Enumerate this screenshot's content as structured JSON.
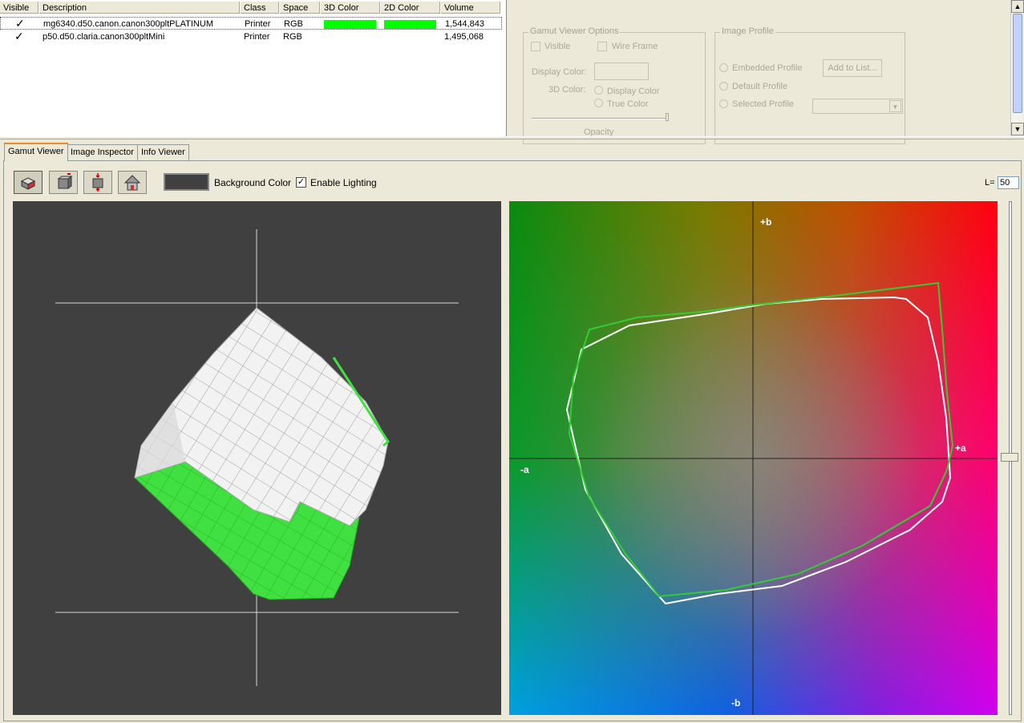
{
  "table": {
    "headers": [
      "Visible",
      "Description",
      "Class",
      "Space",
      "3D Color",
      "2D Color",
      "Volume"
    ],
    "rows": [
      {
        "visible": "✓",
        "description": "mg6340.d50.canon.canon300pltPLATINUM",
        "class": "Printer",
        "space": "RGB",
        "color3d": "#00ff00",
        "color2d": "#00ff00",
        "volume": "1,544,843"
      },
      {
        "visible": "✓",
        "description": "p50.d50.claria.canon300pltMini",
        "class": "Printer",
        "space": "RGB",
        "color3d": "",
        "color2d": "",
        "volume": "1,495,068"
      }
    ]
  },
  "gamut_options": {
    "title": "Gamut Viewer Options",
    "visible_label": "Visible",
    "wireframe_label": "Wire Frame",
    "display_color_label": "Display Color:",
    "color3d_label": "3D Color:",
    "radio_display_color": "Display Color",
    "radio_true_color": "True Color",
    "opacity_label": "Opacity"
  },
  "image_profile": {
    "title": "Image Profile",
    "embedded": "Embedded Profile",
    "default": "Default Profile",
    "selected": "Selected Profile",
    "add_button": "Add to List..."
  },
  "tabs": [
    {
      "label": "Gamut Viewer",
      "active": true
    },
    {
      "label": "Image Inspector",
      "active": false
    },
    {
      "label": "Info Viewer",
      "active": false
    }
  ],
  "toolbar": {
    "tools": [
      "rotate-view-icon",
      "box-view-icon",
      "flip-view-icon",
      "home-view-icon"
    ],
    "background_color_label": "Background Color",
    "background_color": "#404040",
    "enable_lighting_label": "Enable Lighting",
    "enable_lighting_checked": true,
    "l_label": "L=",
    "l_value": "50"
  },
  "plot2d": {
    "axis_plus_b": "+b",
    "axis_minus_b": "-b",
    "axis_plus_a": "+a",
    "axis_minus_a": "-a",
    "gamut_line_colors": {
      "platinum": "#33cc33",
      "mini": "#ffffff"
    }
  },
  "colors": {
    "accent_tab": "#e68b2c",
    "gamut_green": "#33ee33",
    "view_background": "#404040"
  }
}
